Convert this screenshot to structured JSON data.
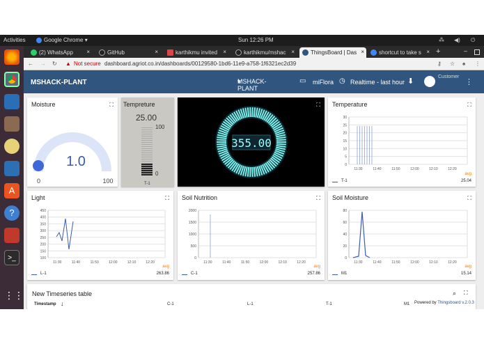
{
  "system": {
    "activities": "Activities",
    "app": "Google Chrome ▾",
    "clock": "Sun 12:26 PM"
  },
  "tabs": [
    {
      "label": "(2) WhatsApp",
      "color": "#25d366"
    },
    {
      "label": "GitHub",
      "color": "#222"
    },
    {
      "label": "karthikmu invited",
      "color": "#d44"
    },
    {
      "label": "karthikmu/mshac",
      "color": "#222"
    },
    {
      "label": "ThingsBoard | Das",
      "color": "#305680"
    },
    {
      "label": "shortcut to take s",
      "color": "#4285f4"
    }
  ],
  "address": {
    "not_secure": "Not secure",
    "url": "dashboard.agriot.co.in/dashboards/00129580-1bd6-11e9-a758-1f6321ec2d39"
  },
  "appbar": {
    "title": "MSHACK-PLANT",
    "dashboard_select": "MSHACK-PLANT",
    "entity": "miFlora",
    "timewindow": "Realtime - last hour",
    "user": "Customer"
  },
  "widgets": {
    "moisture": {
      "title": "Moisture",
      "value": "1.0",
      "min": "0",
      "max": "100",
      "level": 0.01
    },
    "temp_gauge": {
      "title": "Tempreture",
      "value": "25.00",
      "max": "100",
      "min": "0",
      "series": "T-1",
      "level": 0.25
    },
    "lcd": {
      "value": "355.00"
    },
    "temperature": {
      "title": "Temperature",
      "series": "T-1",
      "avg_label": "avg",
      "avg": "25.04",
      "yticks": [
        "30",
        "25",
        "20",
        "15",
        "10",
        "5",
        "0"
      ],
      "xticks": [
        "11:30",
        "11:40",
        "11:50",
        "12:00",
        "12:10",
        "12:20"
      ]
    },
    "light": {
      "title": "Light",
      "series": "L-1",
      "avg_label": "avg",
      "avg": "263.86",
      "yticks": [
        "450",
        "400",
        "350",
        "300",
        "250",
        "200",
        "150",
        "100"
      ],
      "xticks": [
        "11:30",
        "11:40",
        "11:50",
        "12:00",
        "12:10",
        "12:20"
      ]
    },
    "soil_nutrition": {
      "title": "Soil Nutrition",
      "series": "C-1",
      "avg_label": "avg",
      "avg": "257.86",
      "yticks": [
        "2000",
        "1500",
        "1000",
        "500",
        "0"
      ],
      "xticks": [
        "11:30",
        "11:40",
        "11:50",
        "12:00",
        "12:10",
        "12:20"
      ]
    },
    "soil_moisture": {
      "title": "Soil Moisture",
      "series": "M1",
      "avg_label": "avg",
      "avg": "15.14",
      "yticks": [
        "80",
        "60",
        "40",
        "20",
        "0"
      ],
      "xticks": [
        "11:30",
        "11:40",
        "11:50",
        "12:00",
        "12:10",
        "12:20"
      ]
    },
    "table": {
      "title": "New Timeseries table",
      "columns": [
        "Timestamp",
        "C-1",
        "L-1",
        "T-1",
        "M1"
      ],
      "powered_prefix": "Powered by ",
      "powered_link": "Thingsboard v.2.0.3"
    }
  }
}
